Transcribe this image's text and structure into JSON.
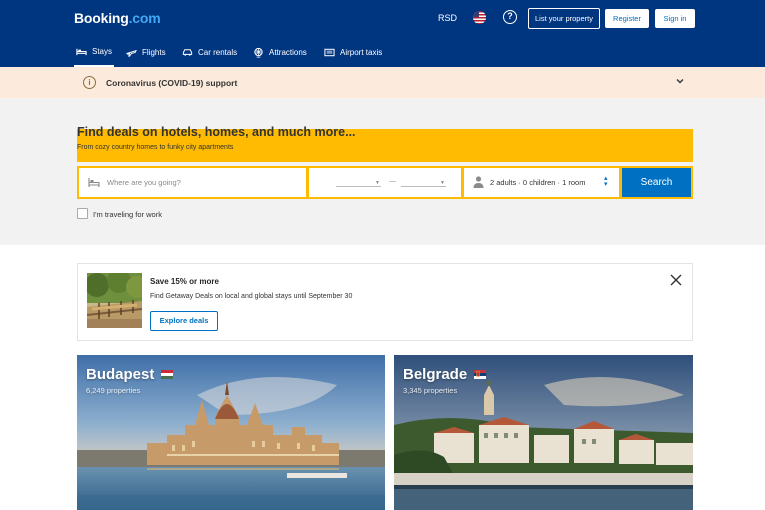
{
  "header": {
    "logo_main": "Booking",
    "logo_tld": ".com",
    "currency": "RSD",
    "flag_icon": "us-flag-icon",
    "help_label": "?",
    "list_property": "List your property",
    "register": "Register",
    "sign_in": "Sign in"
  },
  "nav": {
    "items": [
      {
        "label": "Stays",
        "icon": "bed-icon",
        "active": true
      },
      {
        "label": "Flights",
        "icon": "plane-icon",
        "active": false
      },
      {
        "label": "Car rentals",
        "icon": "car-icon",
        "active": false
      },
      {
        "label": "Attractions",
        "icon": "ferris-wheel-icon",
        "active": false
      },
      {
        "label": "Airport taxis",
        "icon": "taxi-icon",
        "active": false
      }
    ]
  },
  "covid_banner": {
    "icon": "info-icon",
    "icon_glyph": "i",
    "text": "Coronavirus (COVID-19) support"
  },
  "hero": {
    "title": "Find deals on hotels, homes, and much more...",
    "subtitle": "From cozy country homes to funky city apartments"
  },
  "search": {
    "destination_placeholder": "Where are you going?",
    "destination_value": "",
    "date_separator": "—",
    "guests": "2 adults · 0 children · 1 room",
    "search_label": "Search",
    "work_travel_label": "I'm traveling for work",
    "work_travel_checked": false
  },
  "promo": {
    "title": "Save 15% or more",
    "description": "Find Getaway Deals on local and global stays until September 30",
    "button": "Explore deals"
  },
  "destinations": [
    {
      "name": "Budapest",
      "properties": "6,249 properties",
      "flag": "hungary-flag-icon"
    },
    {
      "name": "Belgrade",
      "properties": "3,345 properties",
      "flag": "serbia-flag-icon"
    }
  ],
  "colors": {
    "brand_blue": "#003580",
    "action_blue": "#0071c2",
    "accent_yellow": "#febb02",
    "covid_bg": "#fcebdc"
  }
}
